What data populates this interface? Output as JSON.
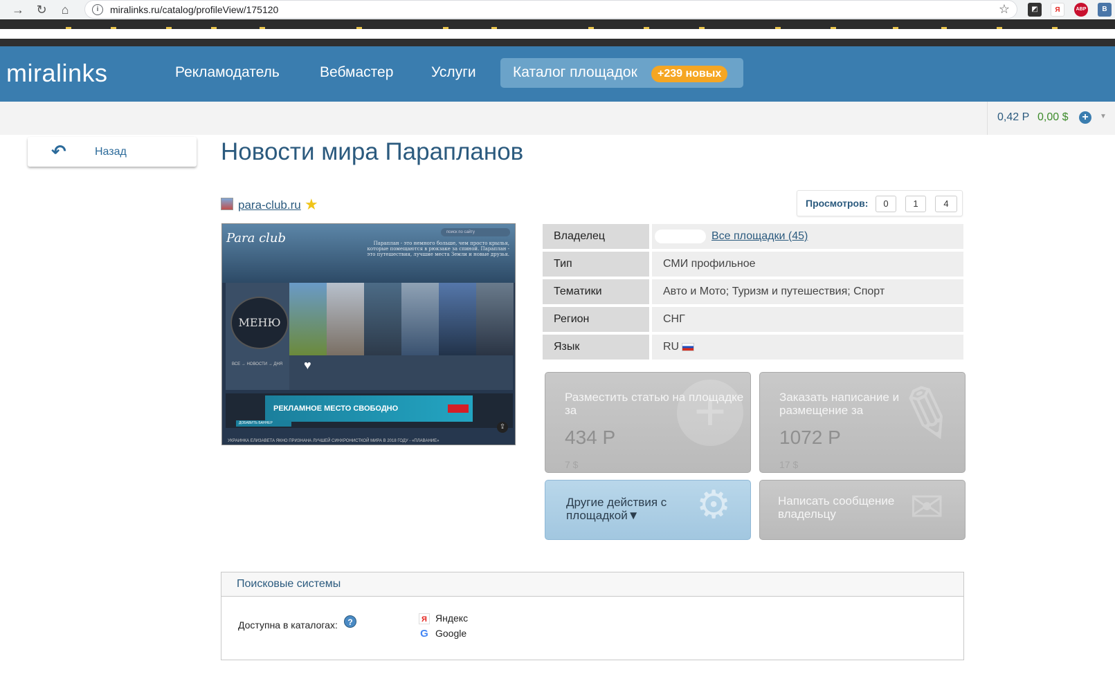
{
  "browser": {
    "url": "miralinks.ru/catalog/profileView/175120",
    "extensions": [
      "Я",
      "ABP",
      "B"
    ]
  },
  "header": {
    "logo": "miralinks",
    "nav": [
      "Рекламодатель",
      "Вебмастер",
      "Услуги"
    ],
    "catalog_label": "Каталог площадок",
    "catalog_badge": "+239 новых"
  },
  "balance": {
    "rub": "0,42 Р",
    "usd": "0,00 $"
  },
  "back_label": "Назад",
  "title": "Новости мира Парапланов",
  "site": {
    "domain": "para-club.ru"
  },
  "views": {
    "label": "Просмотров:",
    "values": [
      "0",
      "1",
      "4"
    ]
  },
  "screenshot": {
    "logo": "Para club",
    "desc": "Параплан - это немного больше, чем просто крылья, которые помещаются в рюкзаке за спиной. Параплан - это путешествия, лучшие места Земли и новые друзья.",
    "search": "поиск по сайту",
    "menu": "МЕНЮ",
    "crumbs": "ВСЕ → НОВОСТИ → ДНЯ",
    "banner": "РЕКЛАМНОЕ МЕСТО СВОБОДНО",
    "add_banner": "ДОБАВИТЬ БАННЕР",
    "bottom": "УКРАИНКА ЕЛИЗАВЕТА ЯКНО ПРИЗНАНА ЛУЧШЕЙ СИНХРОНИСТКОЙ МИРА В 2018 ГОДУ - «ПЛАВАНИЕ»"
  },
  "info": {
    "owner_key": "Владелец",
    "owner_link": "Все площадки (45)",
    "type_key": "Тип",
    "type_val": "СМИ профильное",
    "topics_key": "Тематики",
    "topics_val": "Авто и Мото; Туризм и путешествия; Спорт",
    "region_key": "Регион",
    "region_val": "СНГ",
    "lang_key": "Язык",
    "lang_val": "RU"
  },
  "cards": {
    "place": {
      "title": "Разместить статью на площадке за",
      "price": "434 Р",
      "usd": "7 $"
    },
    "order": {
      "title": "Заказать написание и размещение за",
      "price": "1072 Р",
      "usd": "17 $"
    },
    "other": {
      "title": "Другие действия с площадкой▼"
    },
    "message": {
      "title": "Написать сообщение владельцу"
    }
  },
  "search_systems": {
    "title": "Поисковые системы",
    "avail_label": "Доступна в каталогах:",
    "help": "?",
    "engines": [
      "Яндекс",
      "Google"
    ]
  },
  "colors": {
    "header": "#3a7daf",
    "catalog_badge": "#f5a623",
    "accent_text": "#2b5a7e"
  }
}
